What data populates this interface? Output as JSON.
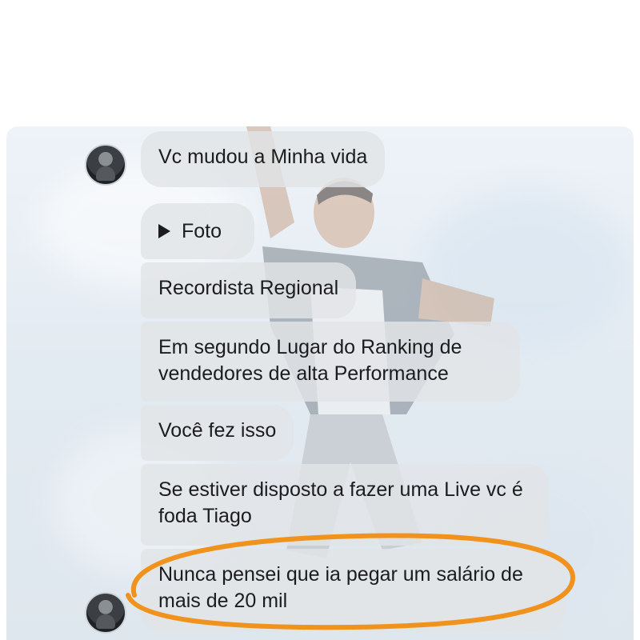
{
  "messages": [
    {
      "text": "Vc mudou a Minha vida"
    },
    {
      "text": "Foto",
      "icon": "play-icon"
    },
    {
      "text": "Recordista Regional"
    },
    {
      "text": "Em segundo Lugar do Ranking de vendedores de alta Performance"
    },
    {
      "text": "Você fez isso"
    },
    {
      "text": "Se estiver disposto a fazer uma Live vc é foda Tiago"
    },
    {
      "text": "Nunca pensei que ia pegar um salário de mais de 20 mil"
    }
  ],
  "colors": {
    "bubble": "#e2e4e7",
    "text": "#1c1c1e",
    "highlight": "#f0921c"
  }
}
